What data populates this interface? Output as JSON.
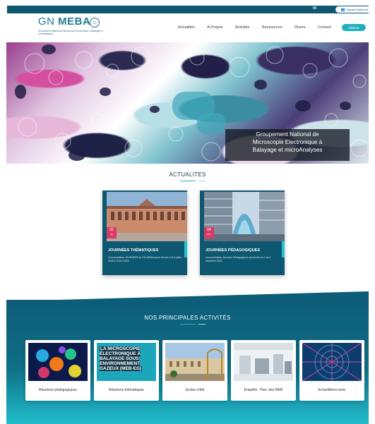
{
  "topbar": {
    "linkedin": "in",
    "member_label": "Espace Adhérent",
    "member_icon": "users-icon"
  },
  "logo": {
    "acronym_left": "GN",
    "acronym_right": "MEBA",
    "tagline": "Groupement National de Microscopie Electronique à Balayage et microAnalyses"
  },
  "nav": {
    "items": [
      {
        "label": "Actualités"
      },
      {
        "label": "A Propos"
      },
      {
        "label": "Activités"
      },
      {
        "label": "Ressources"
      },
      {
        "label": "Divers"
      },
      {
        "label": "Contact"
      }
    ],
    "cta": "Adhérer"
  },
  "hero": {
    "caption_line1": "Groupement National de",
    "caption_line2": "Microscopie Electronique à",
    "caption_line3": "Balayage et microAnalyses"
  },
  "news": {
    "title": "ACTUALITES",
    "cards": [
      {
        "day": "02",
        "month": "Jul",
        "title": "JOURNÉES THÉMATIQUES",
        "desc": "Les prochaines JOURNÉES du GN-MEBA auront lieu les 2 et 3 juillet 2025 à TOULOUSE"
      },
      {
        "day": "04",
        "month": "Déc",
        "title": "JOURNÉES PÉDAGOGIQUES",
        "desc": "Les prochaines Journées Pédagogiques auront lieu du 1 au 4 décembre 2025"
      }
    ]
  },
  "activities": {
    "title": "NOS PRINCIPALES ACTIVITÉS",
    "cards": [
      {
        "label": "Réunions pédagogiques"
      },
      {
        "label": "Réunions thématiques",
        "overlay": "LA MICROSCOPIE ÉLECTRONIQUE À BALAYAGE SOUS ENVIRONNEMENT GAZEUX (MEB-EG)"
      },
      {
        "label": "Ecoles d'été"
      },
      {
        "label": "Enquête : Parc des MEB"
      },
      {
        "label": "Echantillons tests"
      }
    ]
  },
  "colors": {
    "primary": "#0e5771",
    "accent": "#1fb0be",
    "date_badge": "#d93a6a"
  }
}
